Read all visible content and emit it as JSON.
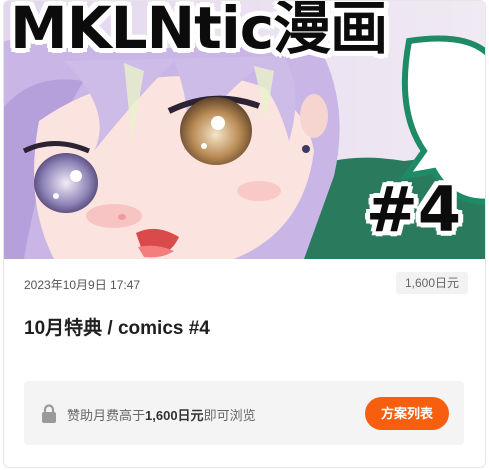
{
  "post": {
    "thumbnail": {
      "overlay_title": "MKLNtic漫画",
      "overlay_issue": "#4",
      "colors": {
        "hair": "#c9b6e6",
        "skin": "#fbe3df",
        "eye": "#a77a4c",
        "speech_bubble_border": "#1f8a66"
      }
    },
    "date": "2023年10月9日 17:47",
    "price": "1,600日元",
    "title": "10月特典 / comics #4",
    "lock": {
      "icon": "lock-icon",
      "text_before": "赞助月费高于",
      "text_amount": "1,600日元",
      "text_after": "即可浏览",
      "button_label": "方案列表",
      "button_color": "#f75f0f"
    }
  }
}
